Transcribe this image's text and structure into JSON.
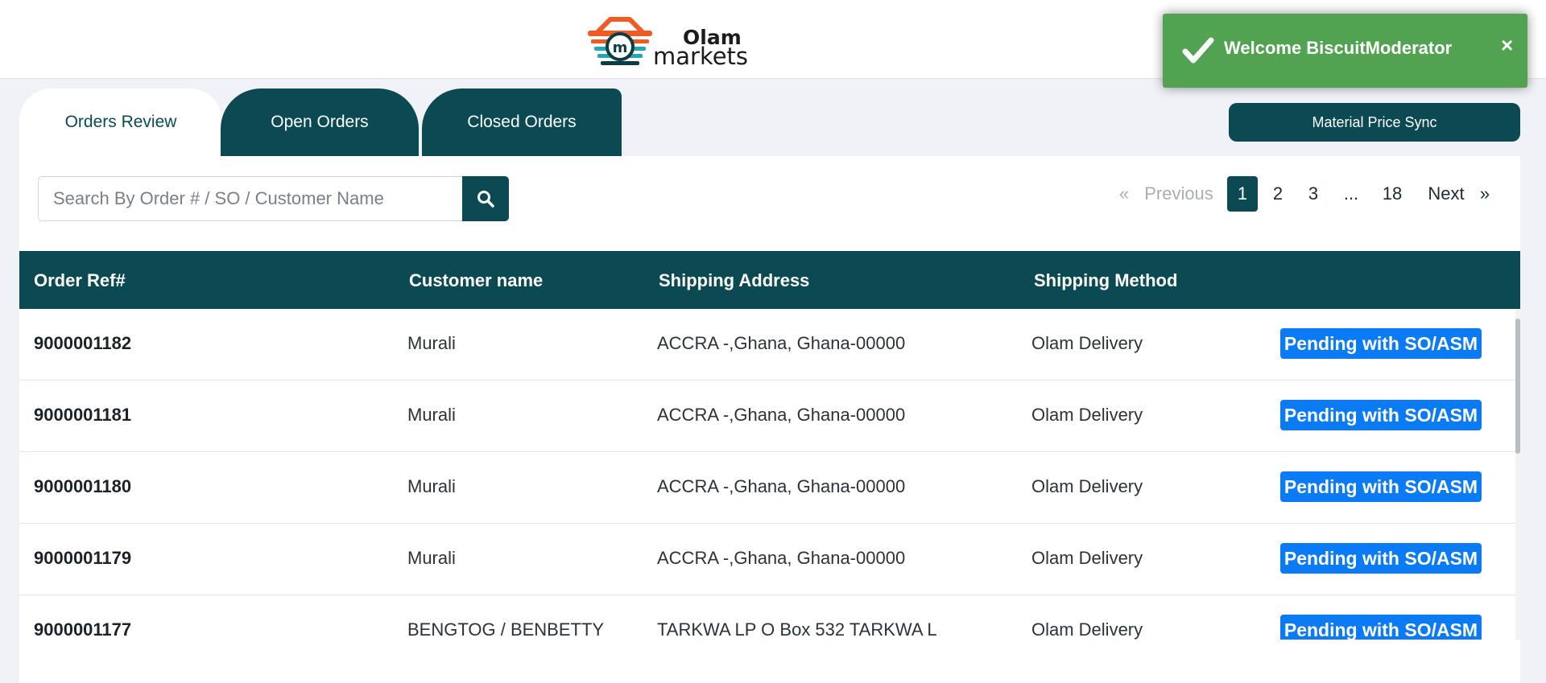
{
  "header": {
    "logo_top": "Olam",
    "logo_bottom": "markets",
    "logo_colors": {
      "orange": "#f15a22",
      "teal": "#23a6b5",
      "dark": "#0c3d45"
    }
  },
  "toast": {
    "message": "Welcome BiscuitModerator",
    "close": "×",
    "color": "#51a351"
  },
  "tabs": [
    {
      "label": "Orders Review",
      "active": true
    },
    {
      "label": "Open Orders",
      "active": false
    },
    {
      "label": "Closed Orders",
      "active": false
    }
  ],
  "sync_button": "Material Price Sync",
  "search": {
    "placeholder": "Search By Order # / SO / Customer Name",
    "value": ""
  },
  "pagination": {
    "prev_arrow": "«",
    "prev": "Previous",
    "pages": [
      "1",
      "2",
      "3",
      "...",
      "18"
    ],
    "current": "1",
    "next": "Next",
    "next_arrow": "»"
  },
  "table": {
    "headers": [
      "Order Ref#",
      "Customer name",
      "Shipping Address",
      "Shipping Method",
      ""
    ],
    "rows": [
      {
        "ref": "9000001182",
        "customer": "Murali",
        "address": "ACCRA -,Ghana, Ghana-00000",
        "method": "Olam Delivery",
        "status": "Pending with SO/ASM"
      },
      {
        "ref": "9000001181",
        "customer": "Murali",
        "address": "ACCRA -,Ghana, Ghana-00000",
        "method": "Olam Delivery",
        "status": "Pending with SO/ASM"
      },
      {
        "ref": "9000001180",
        "customer": "Murali",
        "address": "ACCRA -,Ghana, Ghana-00000",
        "method": "Olam Delivery",
        "status": "Pending with SO/ASM"
      },
      {
        "ref": "9000001179",
        "customer": "Murali",
        "address": "ACCRA -,Ghana, Ghana-00000",
        "method": "Olam Delivery",
        "status": "Pending with SO/ASM"
      },
      {
        "ref": "9000001177",
        "customer": "BENGTOG / BENBETTY",
        "address": "TARKWA LP O Box 532 TARKWA L",
        "method": "Olam Delivery",
        "status": "Pending with SO/ASM"
      }
    ]
  },
  "colors": {
    "primary": "#0c4a53",
    "badge": "#0b7bf5",
    "background": "#f1f2f8"
  }
}
